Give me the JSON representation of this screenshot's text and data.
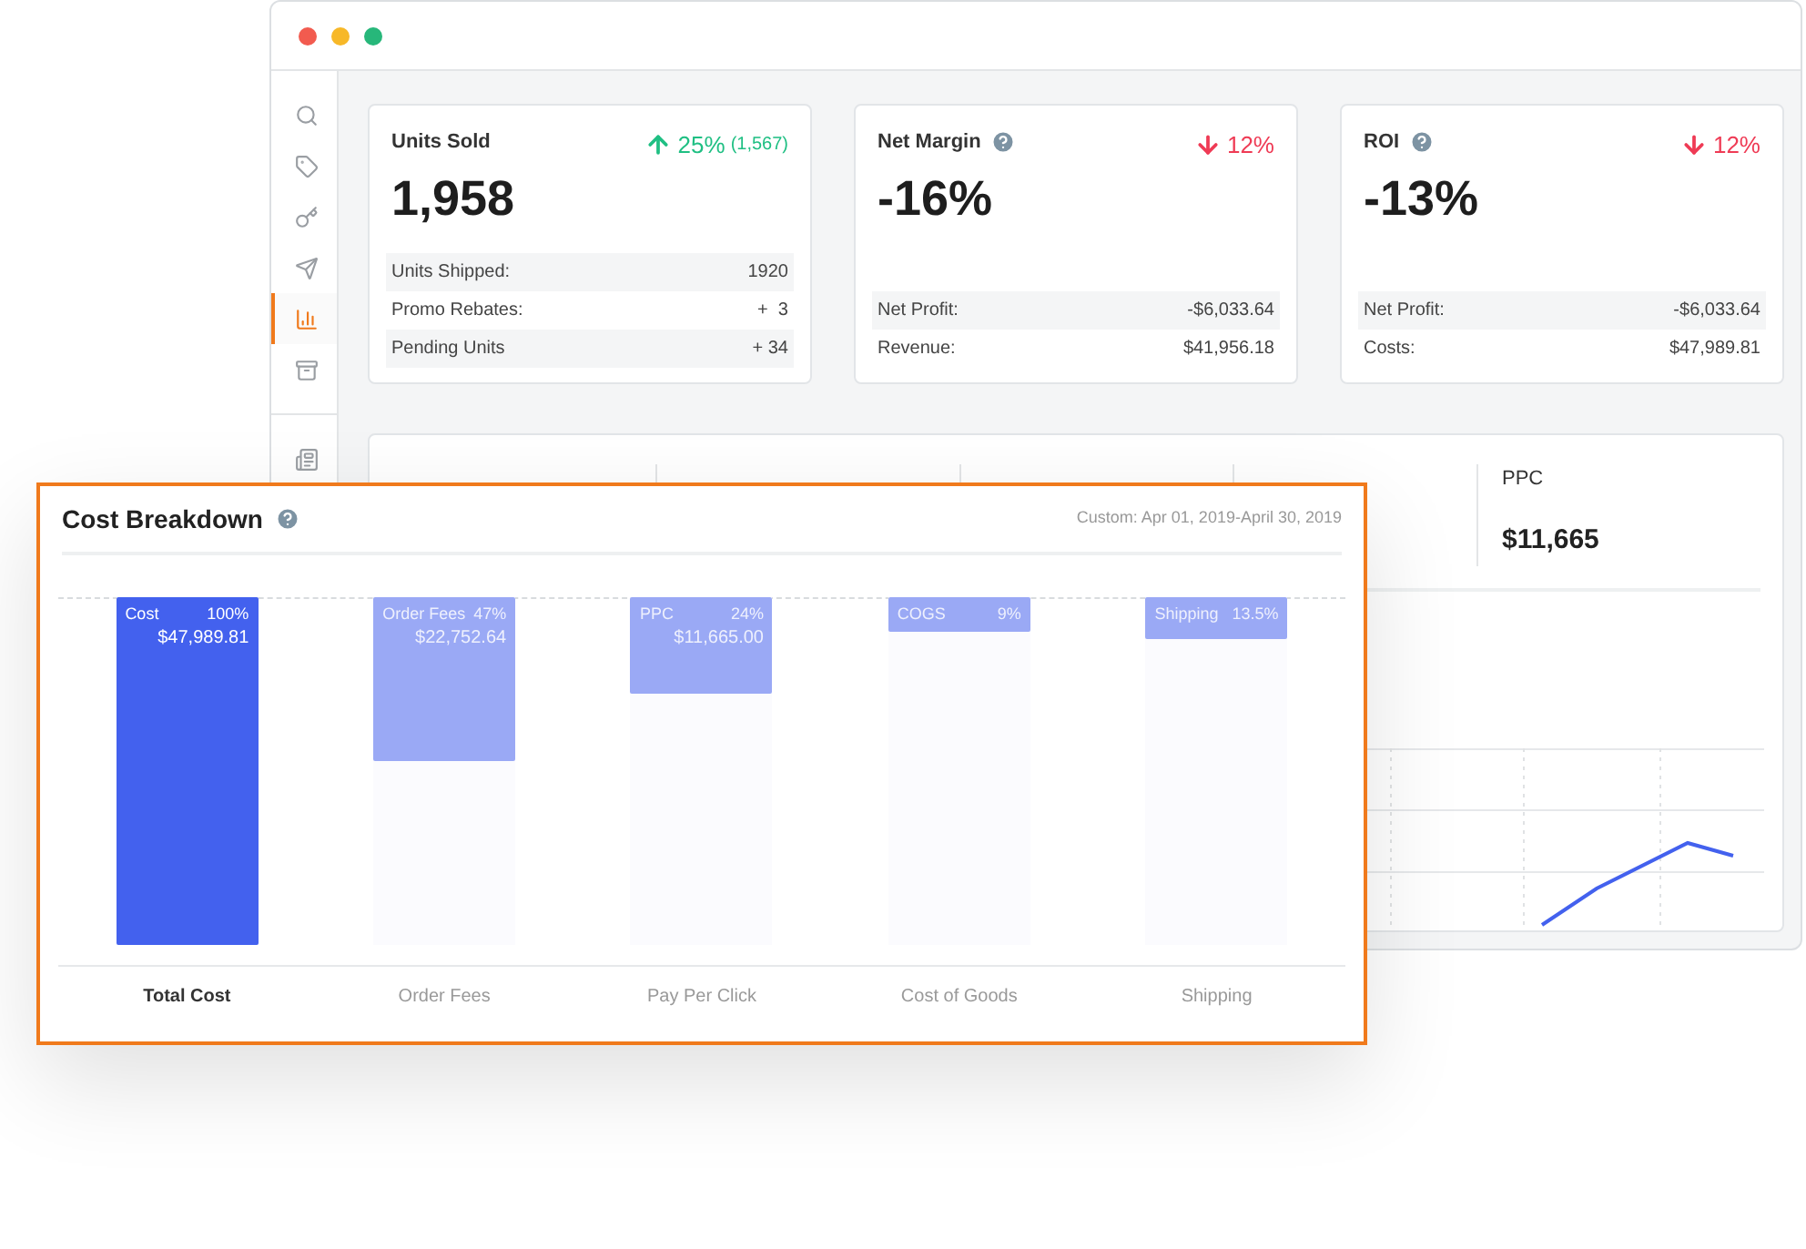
{
  "sidebar": {
    "items": [
      {
        "kind": "search",
        "selected": false
      },
      {
        "kind": "tag",
        "selected": false
      },
      {
        "kind": "key",
        "selected": false
      },
      {
        "kind": "send",
        "selected": false
      },
      {
        "kind": "chart",
        "selected": true
      },
      {
        "kind": "box",
        "selected": false
      },
      {
        "kind": "news",
        "selected": false
      }
    ]
  },
  "cards": [
    {
      "title": "Units Sold",
      "help": false,
      "change": {
        "kind": "up",
        "value": "25%",
        "detail": "(1,567)"
      },
      "value": "1,958",
      "rows": [
        {
          "label": "Units Shipped:",
          "value": "1920"
        },
        {
          "label": "Promo Rebates:",
          "value": "+  3"
        },
        {
          "label": "Pending Units",
          "value": "+ 34"
        }
      ]
    },
    {
      "title": "Net Margin",
      "help": true,
      "change": {
        "kind": "down",
        "value": "12%"
      },
      "value": "-16%",
      "rows": [
        {
          "label": "Net Profit:",
          "value": "-$6,033.64"
        },
        {
          "label": "Revenue:",
          "value": "$41,956.18"
        }
      ]
    },
    {
      "title": "ROI",
      "help": true,
      "change": {
        "kind": "down",
        "value": "12%"
      },
      "value": "-13%",
      "rows": [
        {
          "label": "Net Profit:",
          "value": "-$6,033.64"
        },
        {
          "label": "Costs:",
          "value": "$47,989.81"
        }
      ]
    }
  ],
  "metrics": [
    {
      "label": "PPC",
      "value": "$11,665"
    }
  ],
  "cost_breakdown": {
    "title": "Cost Breakdown",
    "date_range": "Custom: Apr 01, 2019-April 30, 2019",
    "bars": [
      {
        "kind": "total",
        "name": "Cost",
        "share": "100%",
        "amount": "$47,989.81",
        "level": 1,
        "label": "Total Cost"
      },
      {
        "kind": "part",
        "name": "Order Fees",
        "share": "47%",
        "amount": "$22,752.64",
        "level": 0.47,
        "label": "Order Fees"
      },
      {
        "kind": "part",
        "name": "PPC",
        "share": "24%",
        "amount": "$11,665.00",
        "level": 0.28,
        "label": "Pay Per Click"
      },
      {
        "kind": "part",
        "name": "COGS",
        "share": "9%",
        "level": 0.1,
        "label": "Cost of Goods"
      },
      {
        "kind": "part",
        "name": "Shipping",
        "share": "13.5%",
        "level": 0.12,
        "label": "Shipping"
      }
    ]
  }
}
